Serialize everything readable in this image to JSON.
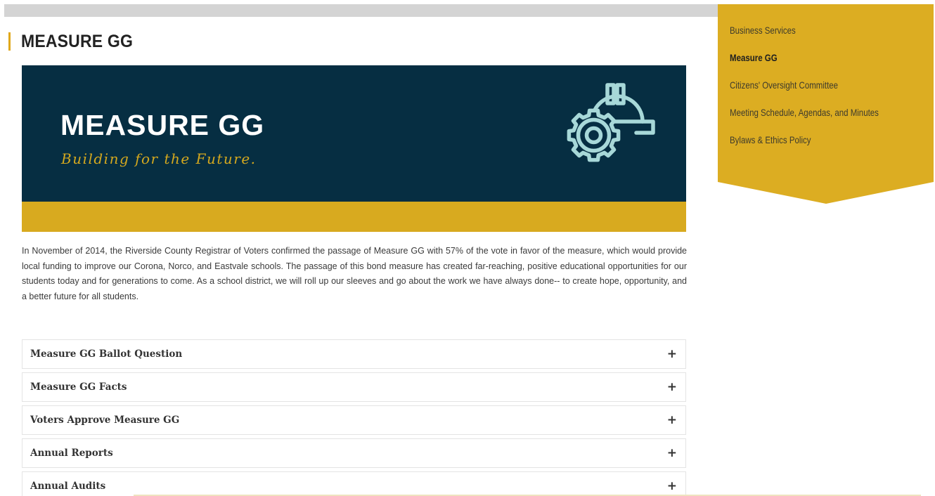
{
  "page": {
    "title": "MEASURE GG"
  },
  "banner": {
    "heading": "MEASURE GG",
    "tagline": "Building for the Future.",
    "icon": "gear-hardhat-icon",
    "colors": {
      "background": "#062e42",
      "accent": "#d8aa1f",
      "icon": "#a7d8d8"
    }
  },
  "intro": {
    "text": "In November of 2014, the Riverside County Registrar of Voters confirmed the passage of Measure GG with 57% of the vote in favor of the measure, which would provide local funding to improve our Corona, Norco, and Eastvale schools. The passage of this bond measure has created far-reaching, positive educational opportunities for our students today and for generations to come. As a school district, we will roll up our sleeves and go about the work we have always done-- to create hope, opportunity, and a better future for all students."
  },
  "accordion": {
    "expand_icon": "plus-icon",
    "expand_symbol": "+",
    "items": [
      {
        "label": "Measure GG Ballot Question"
      },
      {
        "label": "Measure GG Facts"
      },
      {
        "label": "Voters Approve Measure GG"
      },
      {
        "label": "Annual Reports"
      },
      {
        "label": "Annual Audits"
      }
    ]
  },
  "sidebar": {
    "background": "#dcad22",
    "items": [
      {
        "label": "Business Services",
        "active": false
      },
      {
        "label": "Measure GG",
        "active": true
      },
      {
        "label": "Citizens' Oversight Committee",
        "active": false
      },
      {
        "label": "Meeting Schedule, Agendas, and Minutes",
        "active": false
      },
      {
        "label": "Bylaws & Ethics Policy",
        "active": false
      }
    ]
  }
}
